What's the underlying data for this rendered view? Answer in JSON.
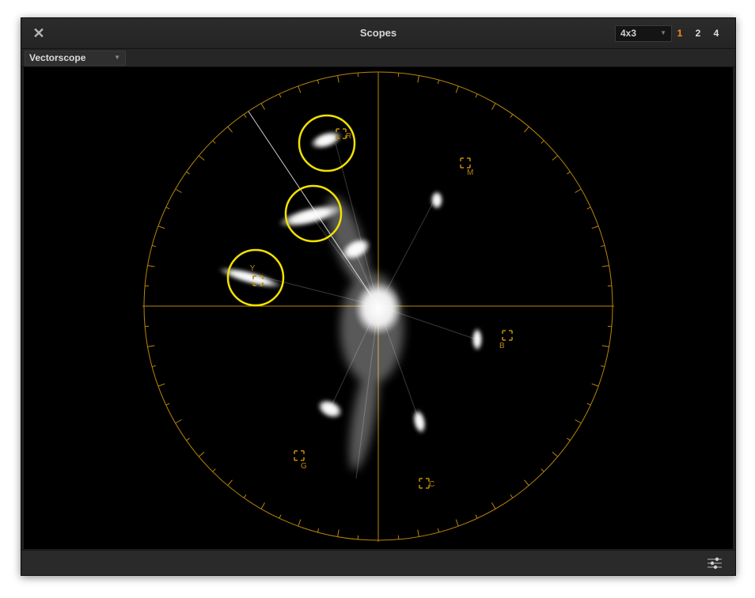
{
  "window": {
    "title": "Scopes",
    "close_icon": "close-icon",
    "layout_select": {
      "value": "4x3"
    },
    "view_buttons": [
      {
        "label": "1",
        "active": true
      },
      {
        "label": "2",
        "active": false
      },
      {
        "label": "4",
        "active": false
      }
    ]
  },
  "toolbar": {
    "scope_select": {
      "value": "Vectorscope"
    }
  },
  "vectorscope": {
    "graticule_color": "#b8860b",
    "highlight_color": "#f2e200",
    "targets": [
      {
        "id": "r",
        "label": "R"
      },
      {
        "id": "m",
        "label": "M"
      },
      {
        "id": "b",
        "label": "B"
      },
      {
        "id": "c",
        "label": "C"
      },
      {
        "id": "g",
        "label": "G"
      },
      {
        "id": "y",
        "label": "Y"
      }
    ]
  },
  "footer": {
    "settings_icon": "sliders-icon"
  }
}
